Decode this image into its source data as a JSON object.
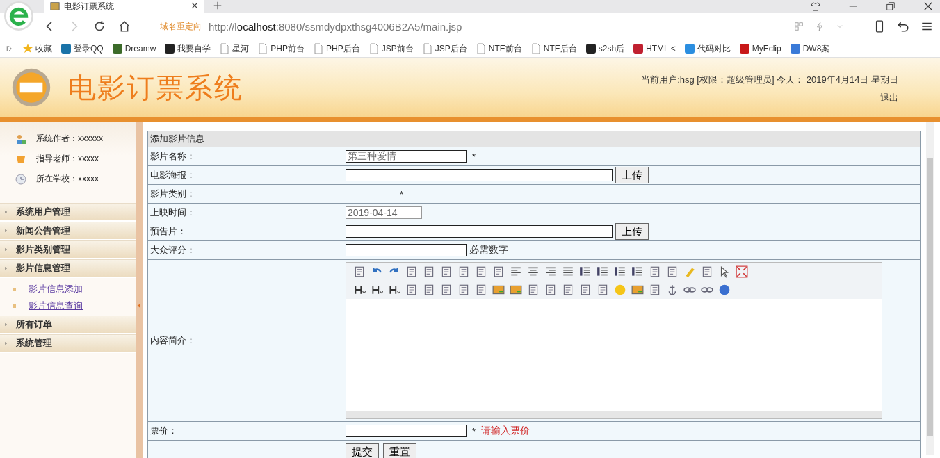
{
  "browser": {
    "tab": {
      "title": "电影订票系统"
    },
    "redirect_label": "域名重定向",
    "url": {
      "scheme": "http://",
      "host": "localhost",
      "path": ":8080/ssmdydpxthsg4006B2A5/main.jsp"
    },
    "bookmarks": [
      {
        "label": "收藏",
        "kind": "star"
      },
      {
        "label": "登录QQ",
        "kind": "app"
      },
      {
        "label": "Dreamw",
        "kind": "app"
      },
      {
        "label": "我要自学",
        "kind": "app"
      },
      {
        "label": "星河",
        "kind": "page"
      },
      {
        "label": "PHP前台",
        "kind": "page"
      },
      {
        "label": "PHP后台",
        "kind": "page"
      },
      {
        "label": "JSP前台",
        "kind": "page"
      },
      {
        "label": "JSP后台",
        "kind": "page"
      },
      {
        "label": "NTE前台",
        "kind": "page"
      },
      {
        "label": "NTE后台",
        "kind": "page"
      },
      {
        "label": "s2sh后",
        "kind": "app"
      },
      {
        "label": "HTML <",
        "kind": "app"
      },
      {
        "label": "代码对比",
        "kind": "app"
      },
      {
        "label": "MyEclip",
        "kind": "app"
      },
      {
        "label": "DW8案",
        "kind": "app"
      }
    ]
  },
  "header": {
    "title": "电影订票系统",
    "user_info": "当前用户:hsg [权限：超级管理员] 今天： 2019年4月14日 星期日",
    "logout": "退出"
  },
  "sidebar": {
    "info": [
      {
        "label": "系统作者：xxxxxx",
        "kind": "author"
      },
      {
        "label": "指导老师：xxxxx",
        "kind": "teacher"
      },
      {
        "label": "所在学校：xxxxx",
        "kind": "school"
      }
    ],
    "menu": [
      {
        "label": "系统用户管理"
      },
      {
        "label": "新闻公告管理"
      },
      {
        "label": "影片类别管理"
      },
      {
        "label": "影片信息管理",
        "children": [
          {
            "label": "影片信息添加"
          },
          {
            "label": "影片信息查询"
          }
        ]
      },
      {
        "label": "所有订单"
      },
      {
        "label": "系统管理"
      }
    ]
  },
  "form": {
    "title": "添加影片信息",
    "fields": [
      {
        "label": "影片名称：",
        "kind": "text",
        "value": "第三种爱情",
        "mark": "*"
      },
      {
        "label": "电影海报：",
        "kind": "file",
        "button": "上传"
      },
      {
        "label": "影片类别：",
        "kind": "select",
        "mark": "*"
      },
      {
        "label": "上映时间：",
        "kind": "date",
        "value": "2019-04-14"
      },
      {
        "label": "预告片：",
        "kind": "file",
        "button": "上传"
      },
      {
        "label": "大众评分：",
        "kind": "text",
        "hint": {
          "text": "必需数字",
          "color": "#333333"
        }
      },
      {
        "label": "内容简介：",
        "kind": "editor"
      },
      {
        "label": "票价：",
        "kind": "text",
        "mark": "*",
        "hint": {
          "text": "请输入票价",
          "color": "#d02020"
        }
      }
    ],
    "buttons": [
      "提交",
      "重置"
    ]
  }
}
